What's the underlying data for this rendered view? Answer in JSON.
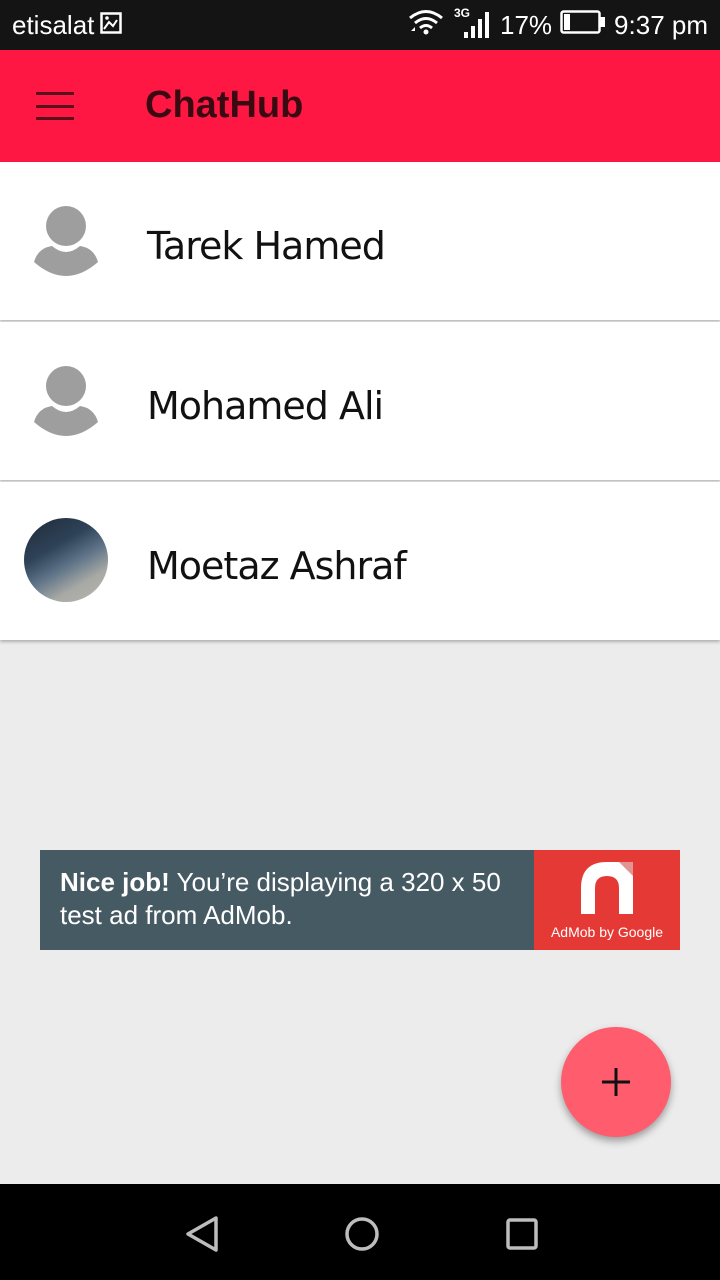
{
  "status_bar": {
    "carrier": "etisalat",
    "network": "3G",
    "battery": "17%",
    "time": "9:37 pm"
  },
  "app_bar": {
    "title": "ChatHub",
    "menu_icon": "hamburger-menu-icon"
  },
  "chats": [
    {
      "name": "Tarek Hamed",
      "avatar": "default-person-icon"
    },
    {
      "name": "Mohamed Ali",
      "avatar": "default-person-icon"
    },
    {
      "name": "Moetaz Ashraf",
      "avatar": "photo"
    }
  ],
  "ad": {
    "headline": "Nice job!",
    "body": " You’re displaying a 320 x 50 test ad from AdMob.",
    "brand": "AdMob by Google",
    "colors": {
      "text_bg": "#465a64",
      "logo_bg": "#e53935"
    }
  },
  "fab": {
    "icon": "plus-icon",
    "color": "#ff5c6e"
  },
  "nav_bar": {
    "icons": [
      "back-triangle-icon",
      "home-circle-icon",
      "recents-square-icon"
    ]
  },
  "colors": {
    "primary": "#ff1744",
    "background": "#ececec"
  }
}
